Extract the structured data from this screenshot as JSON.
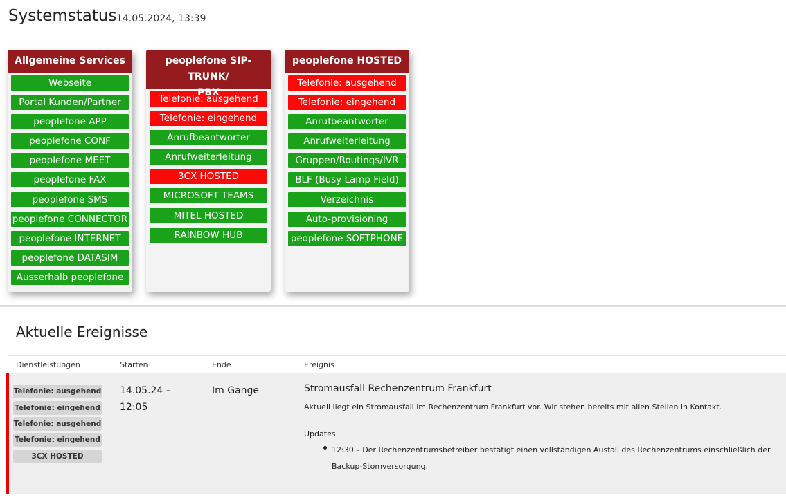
{
  "header": {
    "title": "Systemstatus",
    "datetime": "14.05.2024, 13:39"
  },
  "status_colors": {
    "ok": "#1aa31a",
    "down": "#fb0a0a",
    "card_header": "#951b1e",
    "event_marker": "#ee0000"
  },
  "cards": [
    {
      "title": "Allgemeine Services",
      "items": [
        {
          "label": "Webseite",
          "status": "ok"
        },
        {
          "label": "Portal Kunden/Partner",
          "status": "ok"
        },
        {
          "label": "peoplefone APP",
          "status": "ok"
        },
        {
          "label": "peoplefone CONF",
          "status": "ok"
        },
        {
          "label": "peoplefone MEET",
          "status": "ok"
        },
        {
          "label": "peoplefone FAX",
          "status": "ok"
        },
        {
          "label": "peoplefone SMS",
          "status": "ok"
        },
        {
          "label": "peoplefone CONNECTOR",
          "status": "ok"
        },
        {
          "label": "peoplefone INTERNET",
          "status": "ok"
        },
        {
          "label": "peoplefone DATASIM",
          "status": "ok"
        },
        {
          "label": "Ausserhalb peoplefone",
          "status": "ok"
        }
      ]
    },
    {
      "title_line1": "peoplefone SIP-TRUNK/",
      "title_line2": "PBX",
      "items": [
        {
          "label": "Telefonie: ausgehend",
          "status": "down"
        },
        {
          "label": "Telefonie: eingehend",
          "status": "down"
        },
        {
          "label": "Anrufbeantworter",
          "status": "ok"
        },
        {
          "label": "Anrufweiterleitung",
          "status": "ok"
        },
        {
          "label": "3CX HOSTED",
          "status": "down"
        },
        {
          "label": "MICROSOFT TEAMS",
          "status": "ok"
        },
        {
          "label": "MITEL HOSTED",
          "status": "ok"
        },
        {
          "label": "RAINBOW HUB",
          "status": "ok"
        }
      ]
    },
    {
      "title": "peoplefone HOSTED",
      "items": [
        {
          "label": "Telefonie: ausgehend",
          "status": "down"
        },
        {
          "label": "Telefonie: eingehend",
          "status": "down"
        },
        {
          "label": "Anrufbeantworter",
          "status": "ok"
        },
        {
          "label": "Anrufweiterleitung",
          "status": "ok"
        },
        {
          "label": "Gruppen/Routings/IVR",
          "status": "ok"
        },
        {
          "label": "BLF (Busy Lamp Field)",
          "status": "ok"
        },
        {
          "label": "Verzeichnis",
          "status": "ok"
        },
        {
          "label": "Auto-provisioning",
          "status": "ok"
        },
        {
          "label": "peoplefone SOFTPHONE",
          "status": "ok"
        }
      ]
    }
  ],
  "events": {
    "title": "Aktuelle Ereignisse",
    "columns": [
      "Dienstleistungen",
      "Starten",
      "Ende",
      "Ereignis"
    ],
    "rows": [
      {
        "services": [
          "Telefonie: ausgehend",
          "Telefonie: eingehend",
          "Telefonie: ausgehend",
          "Telefonie: eingehend",
          "3CX HOSTED"
        ],
        "start_line1": "14.05.24 –",
        "start_line2": "12:05",
        "end": "Im Gange",
        "event_title": "Stromausfall Rechenzentrum Frankfurt",
        "description": "Aktuell liegt ein Stromausfall im Rechenzentrum Frankfurt vor. Wir stehen bereits mit allen Stellen in Kontakt.",
        "updates_label": "Updates",
        "updates": [
          "12:30 – Der Rechenzentrumsbetreiber bestätigt einen vollständigen Ausfall des Rechenzentrums einschließlich der Backup-Stomversorgung."
        ]
      }
    ]
  }
}
